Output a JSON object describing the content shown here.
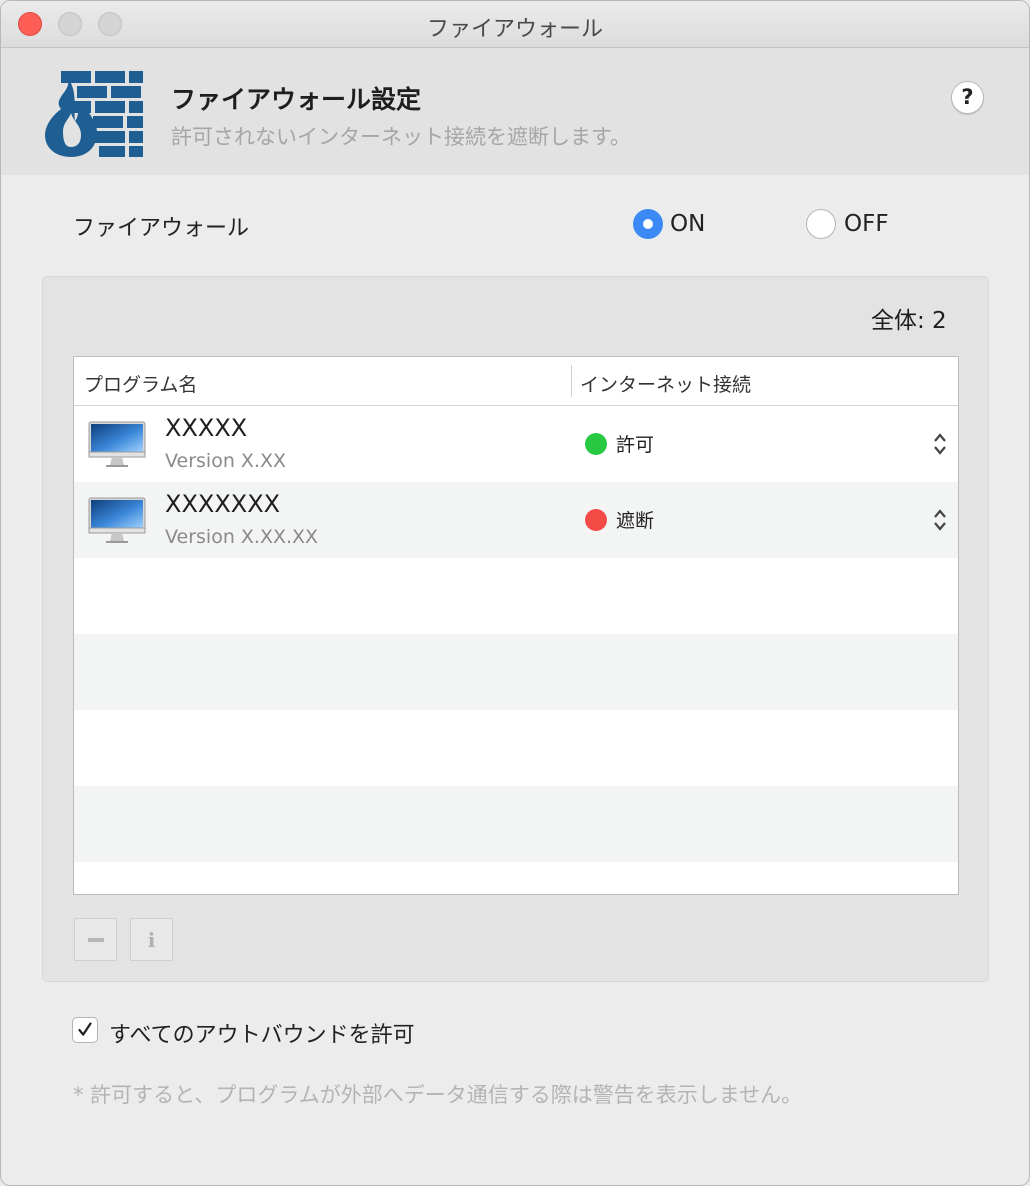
{
  "window": {
    "title": "ファイアウォール"
  },
  "header": {
    "title": "ファイアウォール設定",
    "subtitle": "許可されないインターネット接続を遮断します。",
    "help_label": "?"
  },
  "firewall": {
    "label": "ファイアウォール",
    "on_label": "ON",
    "off_label": "OFF",
    "selected": "ON"
  },
  "total": "全体: 2",
  "table": {
    "headers": {
      "program": "プログラム名",
      "connection": "インターネット接続"
    },
    "rows": [
      {
        "name": "XXXXX",
        "version": "Version X.XX",
        "status": "許可",
        "status_color": "#28c840"
      },
      {
        "name": "XXXXXXX",
        "version": "Version X.XX.XX",
        "status": "遮断",
        "status_color": "#f44a45"
      }
    ]
  },
  "buttons": {
    "info_label": "i"
  },
  "allow_outbound": {
    "label": "すべてのアウトバウンドを許可",
    "checked": true
  },
  "note": "* 許可すると、プログラムが外部へデータ通信する際は警告を表示しません。",
  "colors": {
    "accent": "#3b8af5",
    "brand_blue": "#1f5e92"
  }
}
